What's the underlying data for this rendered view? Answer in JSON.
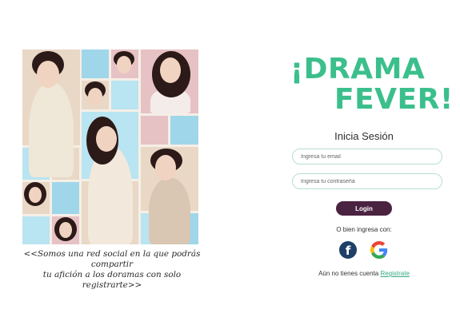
{
  "caption": {
    "line1": "<<Somos una red social en la que podrás compartir",
    "line2": "tu afición a los doramas con solo registrarte>>"
  },
  "logo": {
    "line1": "¡DRAMA",
    "line2": "FEVER!"
  },
  "form": {
    "title": "Inicia Sesión",
    "email_placeholder": "Ingresa tu email",
    "password_placeholder": "Ingresa tu contraseña",
    "login_label": "Login",
    "alt_text": "O bien ingresa con:",
    "signup_prefix": "Aún no tienes cuenta ",
    "signup_link": "Registrate"
  },
  "social": {
    "facebook_glyph": "f"
  },
  "colors": {
    "brand_green": "#3bbf8c",
    "login_bg": "#4a2341",
    "facebook_blue": "#1e3f66"
  }
}
